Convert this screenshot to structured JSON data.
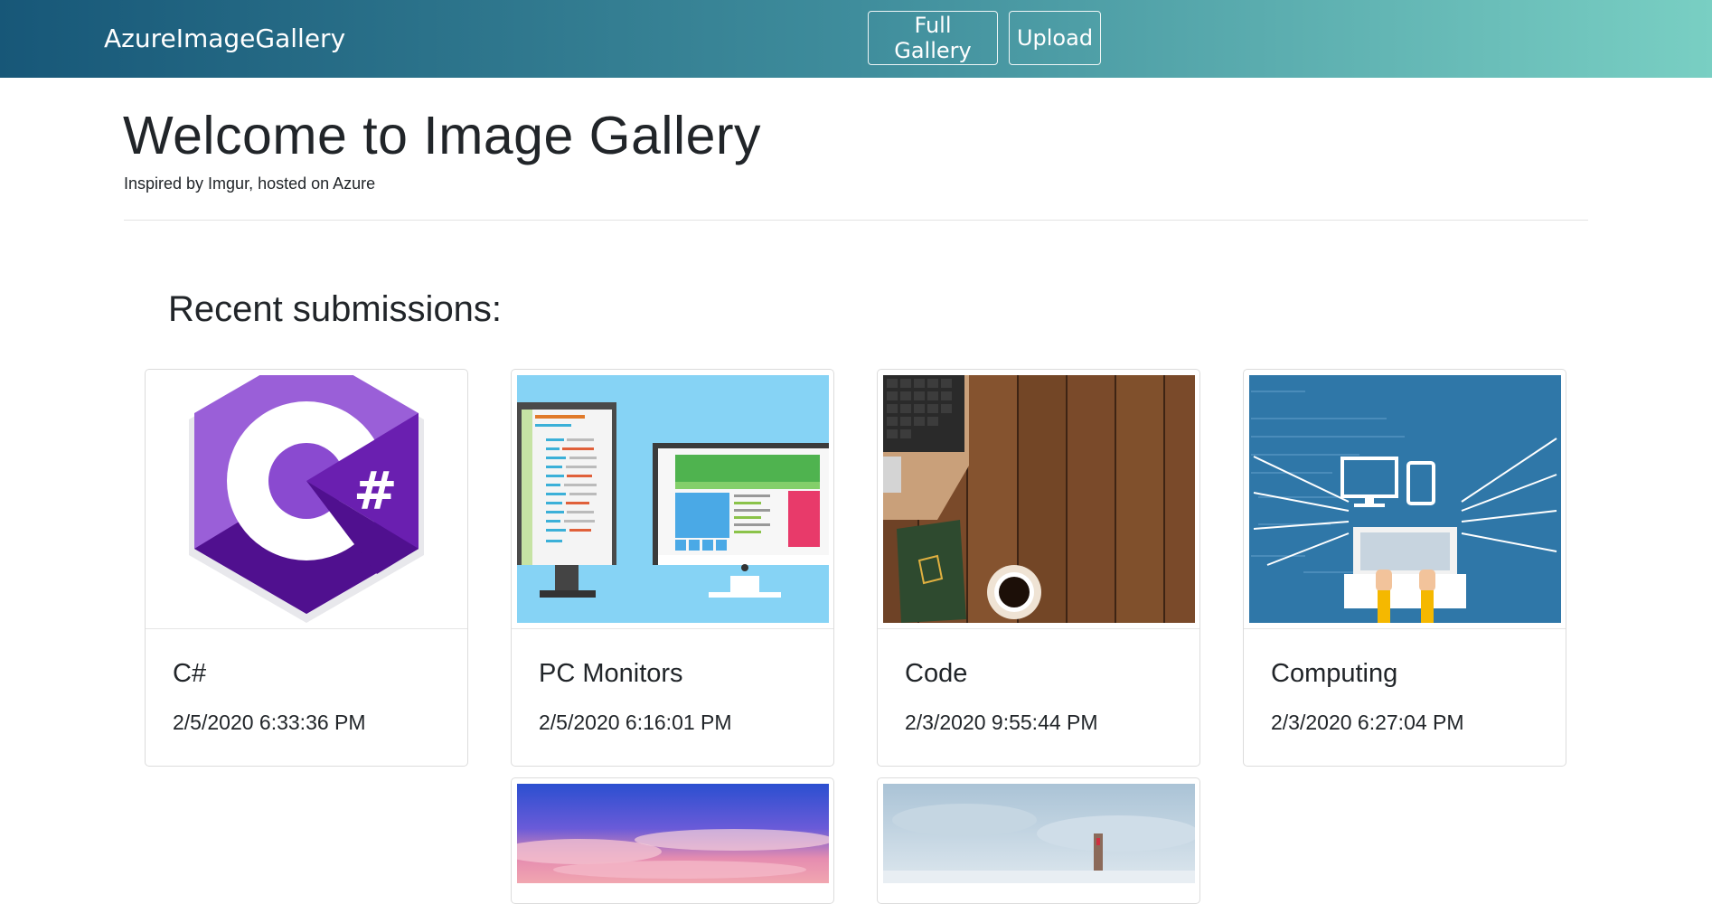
{
  "navbar": {
    "brand": "AzureImageGallery",
    "full_gallery_label": "Full Gallery",
    "upload_label": "Upload"
  },
  "hero": {
    "title": "Welcome to Image Gallery",
    "subtitle": "Inspired by Imgur, hosted on Azure"
  },
  "recent": {
    "heading": "Recent submissions:",
    "cards": [
      {
        "title": "C#",
        "date": "2/5/2020 6:33:36 PM",
        "image": "csharp-logo"
      },
      {
        "title": "PC Monitors",
        "date": "2/5/2020 6:16:01 PM",
        "image": "pc-monitors-illustration"
      },
      {
        "title": "Code",
        "date": "2/3/2020 9:55:44 PM",
        "image": "wooden-desk-laptop-coffee"
      },
      {
        "title": "Computing",
        "date": "2/3/2020 6:27:04 PM",
        "image": "laptop-devices-illustration"
      },
      {
        "title": "",
        "date": "",
        "image": "sunset-clouds"
      },
      {
        "title": "",
        "date": "",
        "image": "sky-landscape"
      }
    ]
  },
  "colors": {
    "navbar_start": "#175778",
    "navbar_end": "#79cfc3",
    "text": "#212529"
  }
}
